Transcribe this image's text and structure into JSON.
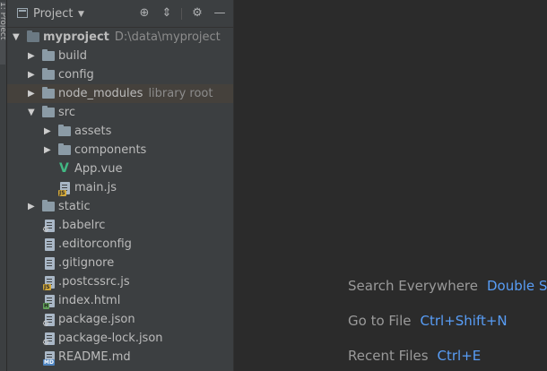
{
  "toolstrip": {
    "tab_label": "1: Project"
  },
  "panel": {
    "title": "Project",
    "icons": {
      "locate": "locate-icon",
      "collapse": "collapse-all-icon",
      "settings": "gear-icon",
      "hide": "minimize-icon"
    }
  },
  "tree": [
    {
      "label": "myproject",
      "sub": "D:\\data\\myproject",
      "kind": "folder",
      "expanded": true,
      "bold": true
    },
    {
      "label": "build",
      "kind": "folder",
      "expanded": false
    },
    {
      "label": "config",
      "kind": "folder",
      "expanded": false
    },
    {
      "label": "node_modules",
      "sub": "library root",
      "kind": "folder",
      "expanded": false,
      "highlight": true
    },
    {
      "label": "src",
      "kind": "folder",
      "expanded": true
    },
    {
      "label": "assets",
      "kind": "folder",
      "expanded": false
    },
    {
      "label": "components",
      "kind": "folder",
      "expanded": false
    },
    {
      "label": "App.vue",
      "kind": "vue"
    },
    {
      "label": "main.js",
      "kind": "js"
    },
    {
      "label": "static",
      "kind": "folder",
      "expanded": false
    },
    {
      "label": ".babelrc",
      "kind": "config"
    },
    {
      "label": ".editorconfig",
      "kind": "text"
    },
    {
      "label": ".gitignore",
      "kind": "text"
    },
    {
      "label": ".postcssrc.js",
      "kind": "js"
    },
    {
      "label": "index.html",
      "kind": "html"
    },
    {
      "label": "package.json",
      "kind": "config"
    },
    {
      "label": "package-lock.json",
      "kind": "config"
    },
    {
      "label": "README.md",
      "kind": "md"
    }
  ],
  "editor": {
    "hints": [
      {
        "action": "Search Everywhere",
        "shortcut": "Double Shift"
      },
      {
        "action": "Go to File",
        "shortcut": "Ctrl+Shift+N"
      },
      {
        "action": "Recent Files",
        "shortcut": "Ctrl+E"
      }
    ]
  },
  "colors": {
    "editor_bg": "#2b2b2b",
    "panel_bg": "#3c3f41",
    "highlight_row": "#45413c",
    "shortcut_blue": "#589df6",
    "vue_green": "#42b883"
  }
}
